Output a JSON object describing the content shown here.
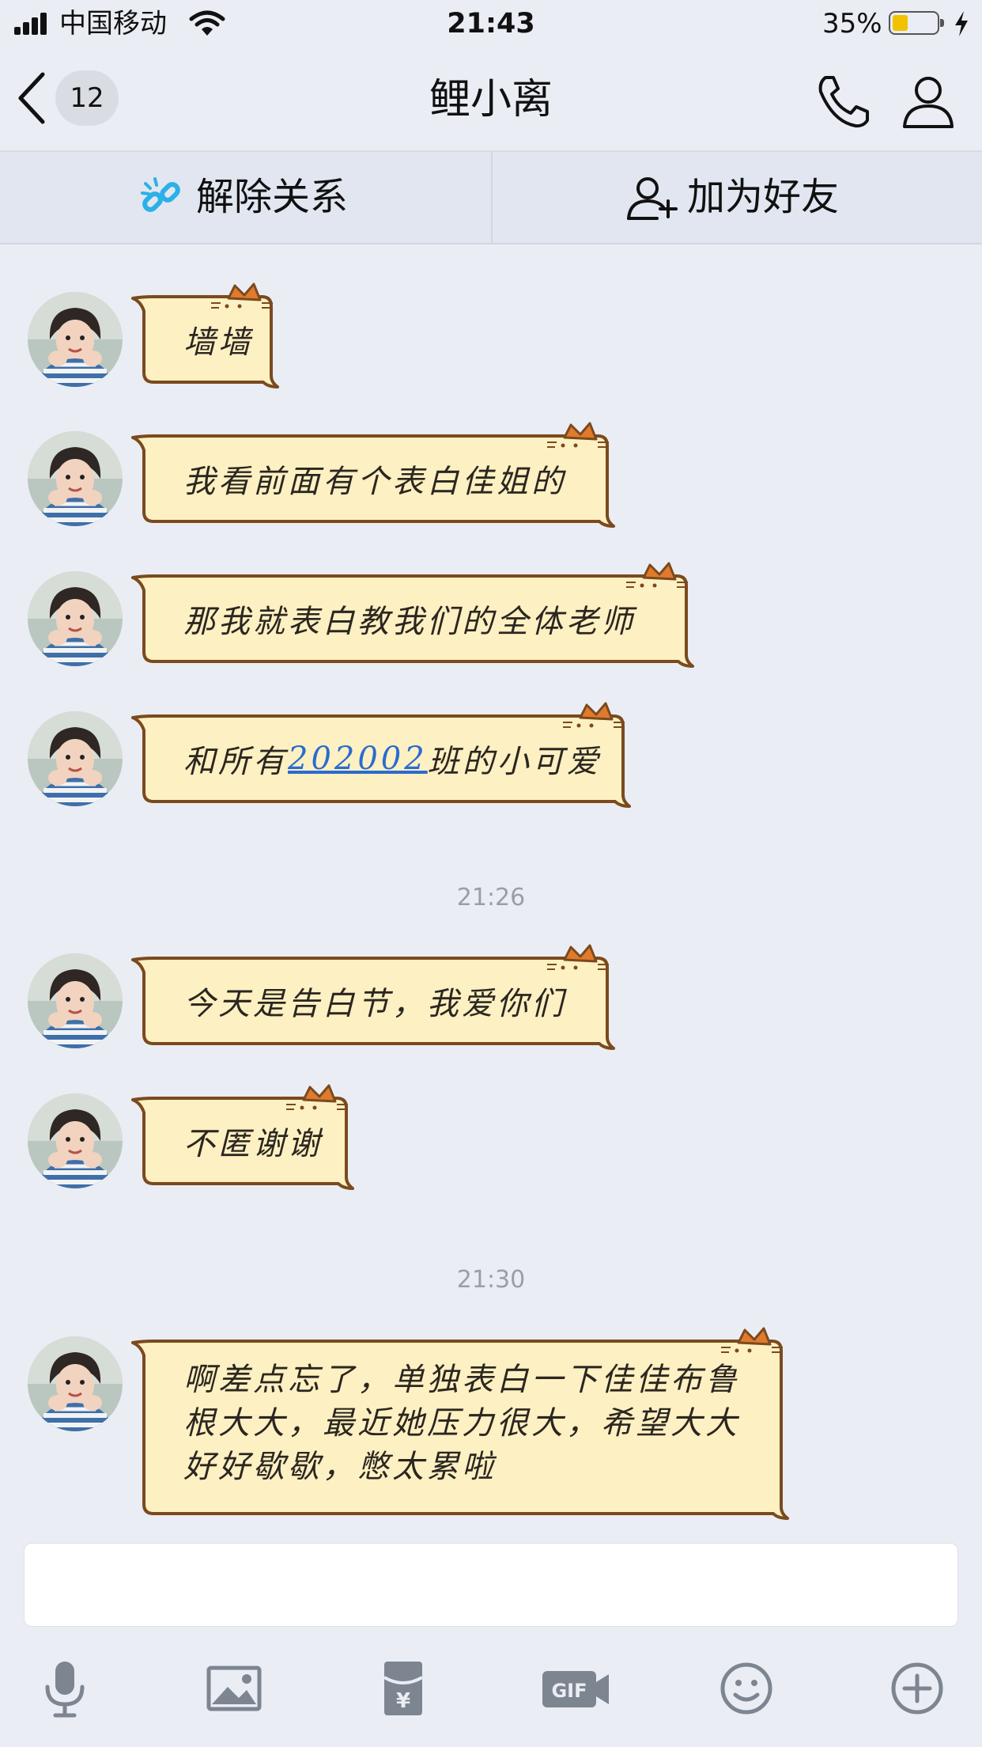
{
  "status_bar": {
    "carrier": "中国移动",
    "time": "21:43",
    "battery_percent": "35%",
    "battery_level": 0.35
  },
  "nav": {
    "unread_count": "12",
    "title": "鲤小离"
  },
  "actions": {
    "unlink_label": "解除关系",
    "add_friend_label": "加为好友"
  },
  "messages": [
    {
      "text": "墙墙"
    },
    {
      "text": "我看前面有个表白佳姐的"
    },
    {
      "text": "那我就表白教我们的全体老师"
    },
    {
      "prefix": "和所有",
      "link": "202002",
      "suffix": "班的小可爱"
    },
    {
      "time": "21:26"
    },
    {
      "text": "今天是告白节，我爱你们"
    },
    {
      "text": "不匿谢谢"
    },
    {
      "time": "21:30"
    },
    {
      "text": "啊差点忘了，单独表白一下佳佳布鲁根大大，最近她压力很大，希望大大好好歇歇，憋太累啦"
    }
  ],
  "colors": {
    "bubble_fill": "#fdf0c2",
    "bubble_border": "#7a4a1e",
    "cat_ear": "#e07a2c",
    "link": "#2a6bd0",
    "accent_icon": "#2bb0e8"
  },
  "icons": [
    "signal-icon",
    "wifi-icon",
    "battery-icon",
    "charging-icon",
    "back-icon",
    "phone-icon",
    "profile-icon",
    "unlink-icon",
    "add-friend-icon",
    "microphone-icon",
    "image-icon",
    "red-packet-icon",
    "gif-icon",
    "emoji-icon",
    "plus-icon"
  ]
}
